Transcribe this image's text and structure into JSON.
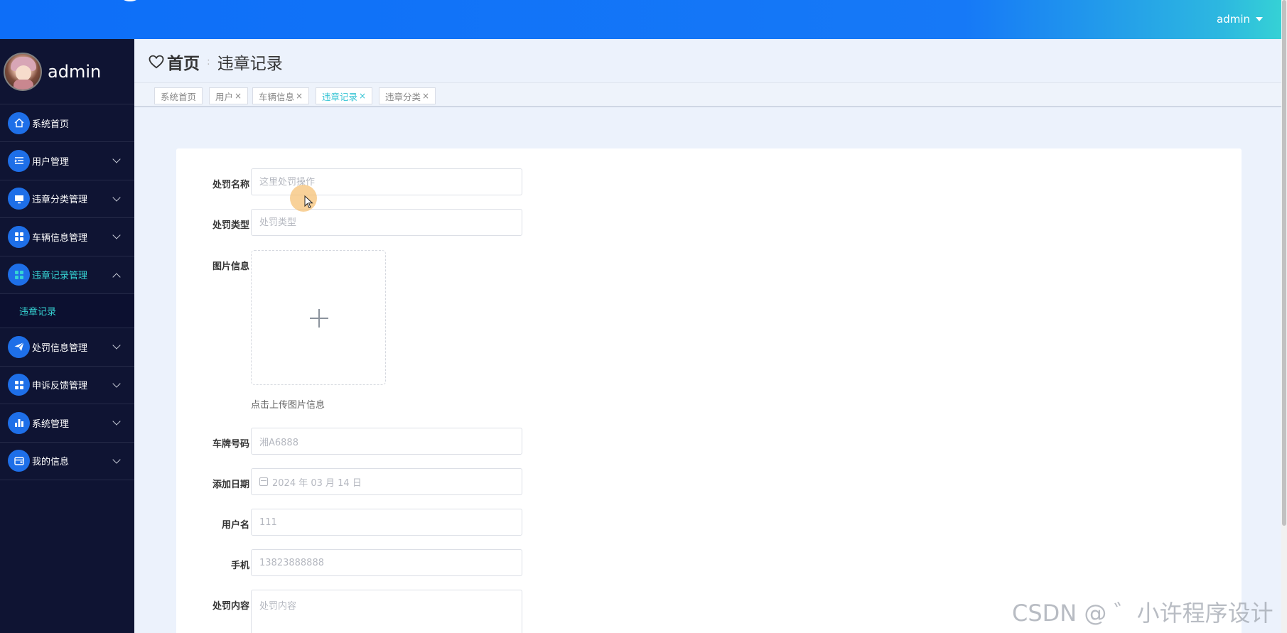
{
  "header": {
    "user": "admin"
  },
  "sidebar": {
    "profile_name": "admin",
    "items": [
      {
        "label": "系统首页",
        "icon": "home-icon"
      },
      {
        "label": "用户管理",
        "icon": "list-icon"
      },
      {
        "label": "违章分类管理",
        "icon": "monitor-icon"
      },
      {
        "label": "车辆信息管理",
        "icon": "grid-icon"
      },
      {
        "label": "违章记录管理",
        "icon": "grid-icon",
        "expanded": true
      },
      {
        "label": "处罚信息管理",
        "icon": "send-icon"
      },
      {
        "label": "申诉反馈管理",
        "icon": "grid-icon"
      },
      {
        "label": "系统管理",
        "icon": "bar-chart-icon"
      },
      {
        "label": "我的信息",
        "icon": "wallet-icon"
      }
    ],
    "sub_item": "违章记录"
  },
  "breadcrumb": {
    "home": "首页",
    "separator": ":",
    "current": "违章记录"
  },
  "tabs": [
    {
      "label": "系统首页"
    },
    {
      "label": "用户"
    },
    {
      "label": "车辆信息"
    },
    {
      "label": "违章记录",
      "active": true
    },
    {
      "label": "违章分类"
    }
  ],
  "tab_close": "×",
  "form": {
    "penalty_name": {
      "label": "处罚名称",
      "placeholder": "这里处罚操作"
    },
    "penalty_type": {
      "label": "处罚类型",
      "placeholder": "处罚类型"
    },
    "image_info": {
      "label": "图片信息",
      "tip": "点击上传图片信息"
    },
    "plate_number": {
      "label": "车牌号码",
      "value": "湘A6888"
    },
    "add_date": {
      "label": "添加日期",
      "value": "2024 年 03 月 14 日"
    },
    "username": {
      "label": "用户名",
      "value": "111"
    },
    "phone": {
      "label": "手机",
      "value": "13823888888"
    },
    "penalty_content": {
      "label": "处罚内容",
      "placeholder": "处罚内容"
    }
  },
  "watermark": "CSDN @ ゛小许程序设计",
  "colors": {
    "header_blue": "#0d6ef8",
    "sidebar_bg": "#0f1433",
    "accent_teal": "#36d4d4",
    "icon_blue": "#1e6fe8"
  }
}
